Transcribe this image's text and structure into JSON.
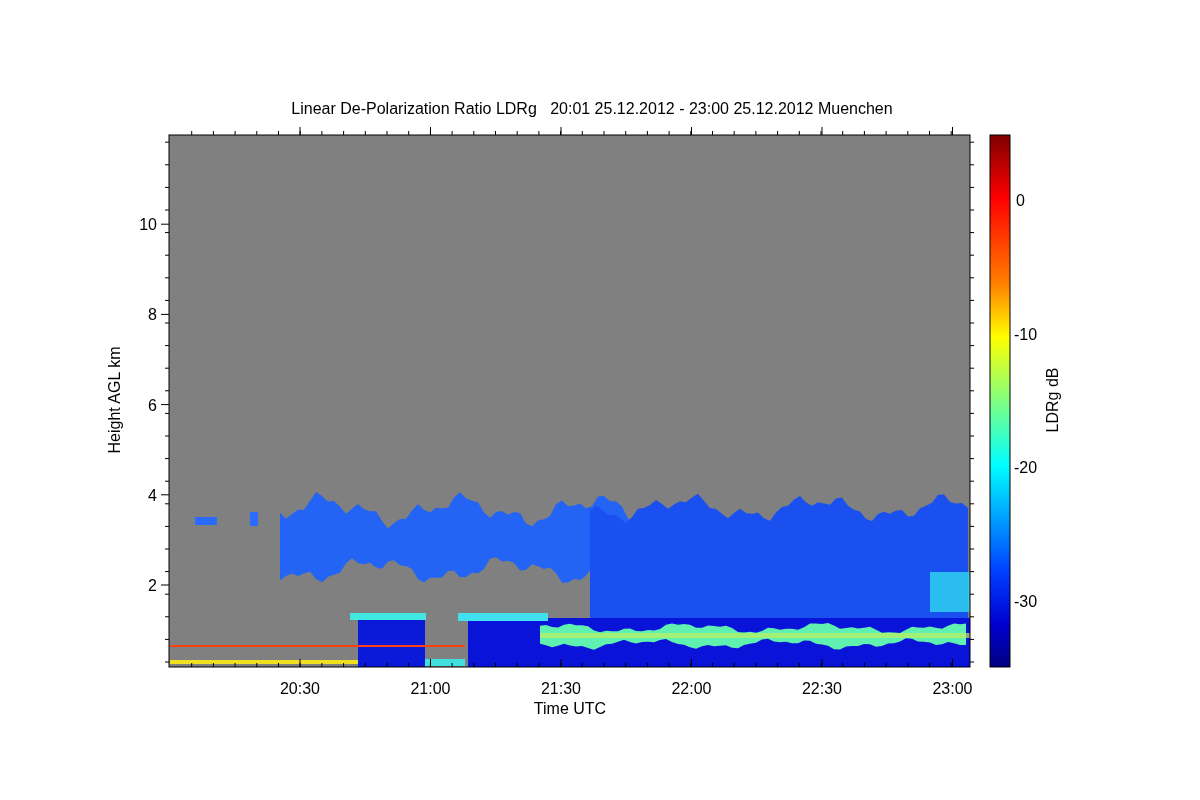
{
  "title": "Linear De-Polarization Ratio LDRg   20:01 25.12.2012 - 23:00 25.12.2012 Muenchen",
  "x_axis": {
    "label": "Time UTC",
    "ticks": [
      "20:30",
      "21:00",
      "21:30",
      "22:00",
      "22:30",
      "23:00"
    ]
  },
  "y_axis": {
    "label": "Height AGL km",
    "ticks": [
      "10",
      "8",
      "6",
      "4",
      "2"
    ]
  },
  "colorbar": {
    "label": "LDRg dB",
    "ticks": [
      "0",
      "-10",
      "-20",
      "-30"
    ]
  }
}
